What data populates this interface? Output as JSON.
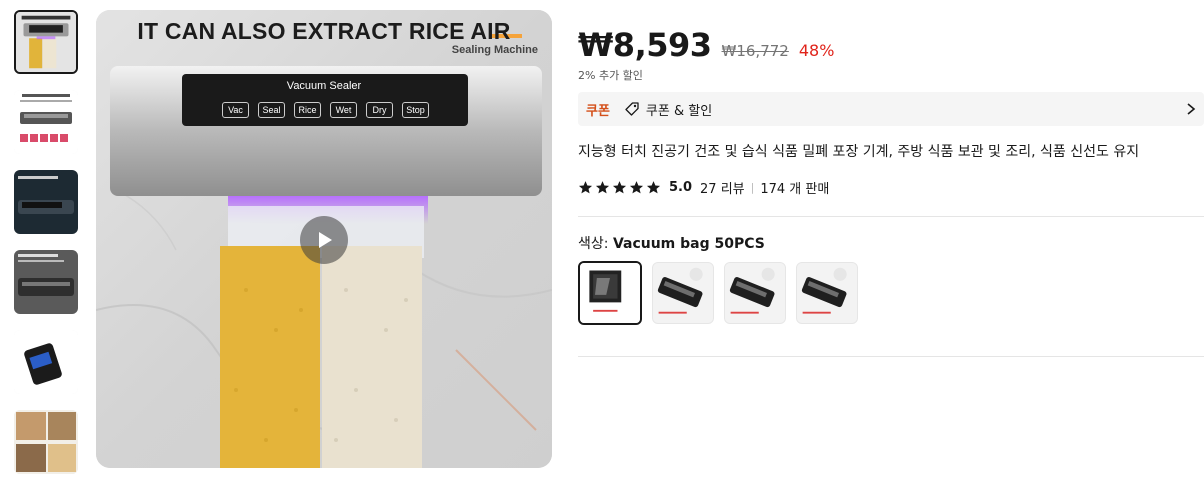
{
  "gallery": {
    "thumbnails": [
      {
        "name": "thumb-1",
        "selected": true
      },
      {
        "name": "thumb-2",
        "selected": false
      },
      {
        "name": "thumb-3",
        "selected": false
      },
      {
        "name": "thumb-4",
        "selected": false
      },
      {
        "name": "thumb-5",
        "selected": false
      },
      {
        "name": "thumb-6",
        "selected": false
      }
    ],
    "main_image": {
      "title": "IT CAN ALSO EXTRACT RICE AIR",
      "subtitle": "Sealing Machine",
      "panel_title": "Vacuum   Sealer",
      "panel_buttons": [
        "Vac",
        "Seal",
        "Rice",
        "Wet",
        "Dry",
        "Stop"
      ],
      "play_icon": "play-icon"
    }
  },
  "product": {
    "price": "₩8,593",
    "original_price": "₩16,772",
    "discount": "48%",
    "extra_discount": "2% 추가 할인",
    "coupon": {
      "tag": "쿠폰",
      "icon": "tag-icon",
      "text": "쿠폰 & 할인",
      "chevron": "chevron-right-icon"
    },
    "title": "지능형 터치 진공기 건조 및 습식 식품 밀폐 포장 기계, 주방 식품 보관 및 조리, 식품 신선도 유지",
    "rating": {
      "stars": 5,
      "score": "5.0",
      "reviews": "27 리뷰",
      "separator": "|",
      "sold": "174 개 판매"
    },
    "color": {
      "label": "색상: ",
      "value": "Vacuum bag 50PCS",
      "options": [
        {
          "name": "Vacuum bag 50PCS",
          "selected": true
        },
        {
          "name": "option-2",
          "selected": false
        },
        {
          "name": "option-3",
          "selected": false
        },
        {
          "name": "option-4",
          "selected": false
        }
      ]
    }
  },
  "colors": {
    "accent_red": "#e0241b",
    "coupon_orange": "#d4501a",
    "title_orange_bar": "#f5a33a"
  }
}
